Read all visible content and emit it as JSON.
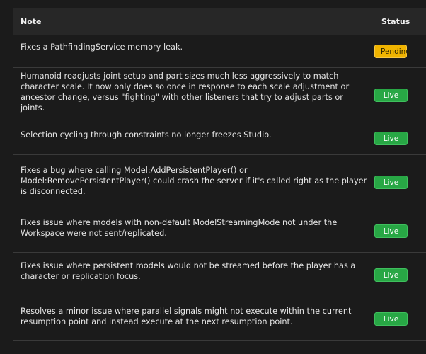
{
  "table": {
    "headers": {
      "note": "Note",
      "status": "Status"
    },
    "rows": [
      {
        "note": "Fixes a PathfindingService memory leak.",
        "status": "Pending",
        "status_type": "pending"
      },
      {
        "note": "Humanoid readjusts joint setup and part sizes much less aggressively to match character scale. It now only does so once in response to each scale adjustment or ancestor change, versus \"fighting\" with other listeners that try to adjust parts or joints.",
        "status": "Live",
        "status_type": "live"
      },
      {
        "note": "Selection cycling through constraints no longer freezes Studio.",
        "status": "Live",
        "status_type": "live"
      },
      {
        "note": "Fixes a bug where calling Model:AddPersistentPlayer() or Model:RemovePersistentPlayer() could crash the server if it's called right as the player is disconnected.",
        "status": "Live",
        "status_type": "live"
      },
      {
        "note": "Fixes issue where models with non-default ModelStreamingMode not under the Workspace were not sent/replicated.",
        "status": "Live",
        "status_type": "live"
      },
      {
        "note": "Fixes issue where persistent models would not be streamed before the player has a character or replication focus.",
        "status": "Live",
        "status_type": "live"
      },
      {
        "note": "Resolves a minor issue where parallel signals might not execute within the current resumption point and instead execute at the next resumption point.",
        "status": "Live",
        "status_type": "live"
      }
    ]
  },
  "colors": {
    "background": "#1b1b1b",
    "header_background": "#272727",
    "live": "#28a745",
    "pending": "#f0b400"
  }
}
